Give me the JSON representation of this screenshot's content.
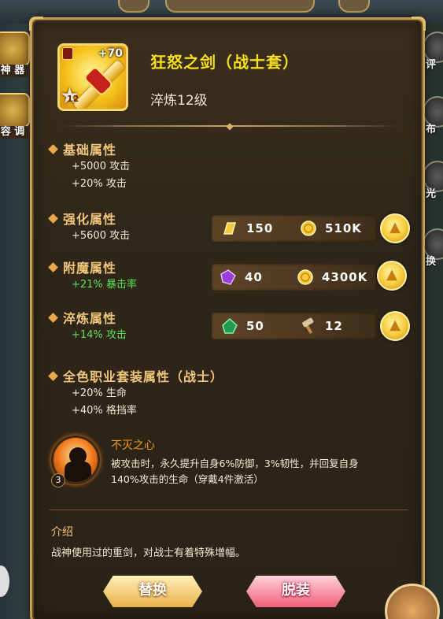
{
  "item": {
    "name": "狂怒之剑（战士套）",
    "enhance_level": "+70",
    "star_level": "12",
    "refine_level": "淬炼12级"
  },
  "side_menu": {
    "left": [
      "神 器",
      "容 调"
    ],
    "right": [
      "评",
      "布",
      "光",
      "换"
    ]
  },
  "sections": {
    "base": {
      "title": "基础属性",
      "stats": [
        "+5000 攻击",
        "+20% 攻击"
      ]
    },
    "enhance": {
      "title": "强化属性",
      "stats": [
        "+5600 攻击"
      ],
      "cost": [
        {
          "icon": "gold-bar-icon",
          "value": "150"
        },
        {
          "icon": "coin-icon",
          "value": "510K"
        }
      ]
    },
    "enchant": {
      "title": "附魔属性",
      "stats": [
        "+21% 暴击率"
      ],
      "cost": [
        {
          "icon": "purple-crystal-icon",
          "value": "40"
        },
        {
          "icon": "coin-icon",
          "value": "4300K"
        }
      ]
    },
    "refine": {
      "title": "淬炼属性",
      "stats": [
        "+14% 攻击"
      ],
      "cost": [
        {
          "icon": "green-gem-icon",
          "value": "50"
        },
        {
          "icon": "hammer-icon",
          "value": "12"
        }
      ]
    },
    "set": {
      "title": "全色职业套装属性（战士）",
      "stats": [
        "+20% 生命",
        "+40% 格挡率"
      ]
    }
  },
  "set_skill": {
    "name": "不灭之心",
    "level": "3",
    "description": "被攻击时，永久提升自身6%防御，3%韧性，并回复自身140%攻击的生命（穿戴4件激活）"
  },
  "intro": {
    "title": "介绍",
    "text": "战神使用过的重剑，对战士有着特殊增幅。"
  },
  "buttons": {
    "replace": "替换",
    "unequip": "脱装"
  },
  "colors": {
    "item_name": "#f8df1c",
    "section_title": "#f0c67c",
    "green_stat": "#5ee05a",
    "skill_name": "#f09a1c"
  }
}
